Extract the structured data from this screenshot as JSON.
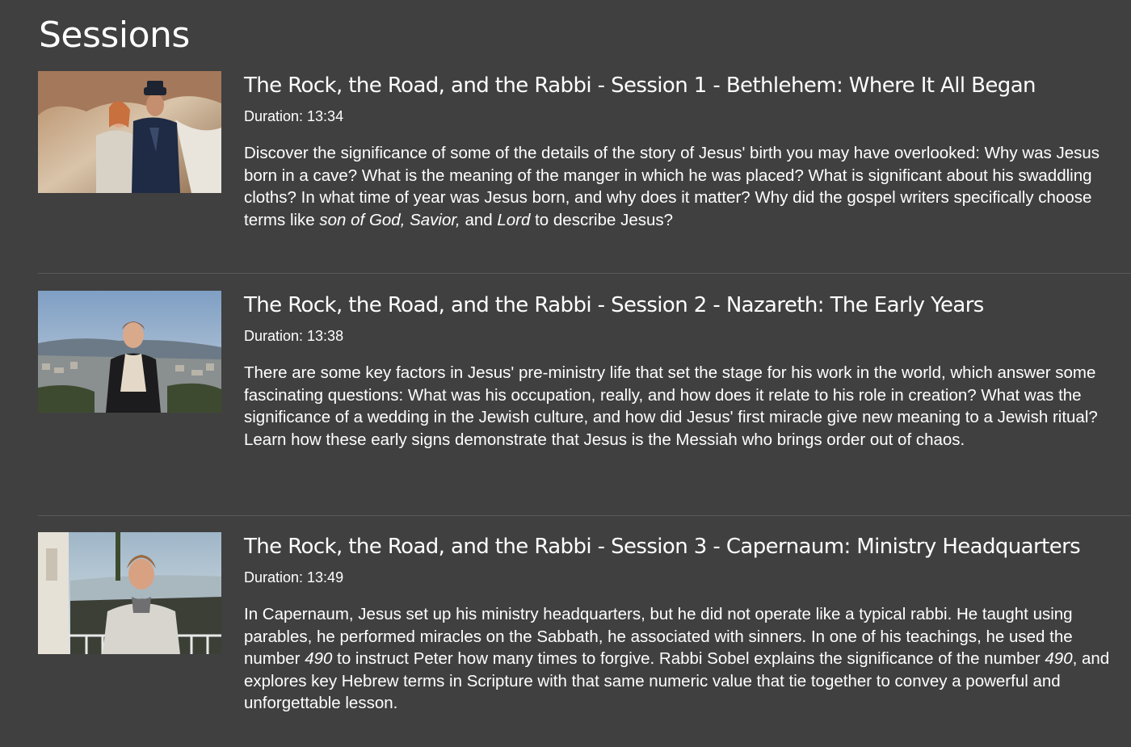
{
  "heading": "Sessions",
  "sessions": [
    {
      "title": "The Rock, the Road, and the Rabbi - Session 1 - Bethlehem: Where It All Began",
      "duration": "Duration: 13:34",
      "thumbnail": "two presenters talking in a cave",
      "description": [
        {
          "t": "Discover the significance of some of the details of the story of Jesus' birth you may have overlooked: Why was Jesus born in a cave? What is the meaning of the manger in which he was placed? What is significant about his swaddling cloths? In what time of year was Jesus born, and why does it matter? Why did the gospel writers specifically choose terms like "
        },
        {
          "t": "son of God, Savior,",
          "i": true
        },
        {
          "t": " and "
        },
        {
          "t": "Lord",
          "i": true
        },
        {
          "t": " to describe Jesus?"
        }
      ]
    },
    {
      "title": "The Rock, the Road, and the Rabbi - Session 2 - Nazareth: The Early Years",
      "duration": "Duration: 13:38",
      "thumbnail": "presenter on hillside overlooking Nazareth",
      "description": [
        {
          "t": "There are some key factors in Jesus' pre-ministry life that set the stage for his work in the world, which answer some fascinating questions: What was his occupation, really, and how does it relate to his role in creation? What was the significance of a wedding in the Jewish culture, and how did Jesus' first miracle give new meaning to a Jewish ritual? Learn how these early signs demonstrate that Jesus is the Messiah who brings order out of chaos."
        }
      ]
    },
    {
      "title": "The Rock, the Road, and the Rabbi - Session 3 - Capernaum: Ministry Headquarters",
      "duration": "Duration: 13:49",
      "thumbnail": "presenter smiling outdoors by the sea",
      "description": [
        {
          "t": "In Capernaum, Jesus set up his ministry headquarters, but he did not operate like a typical rabbi. He taught using parables, he performed miracles on the Sabbath, he associated with sinners. In one of his teachings, he used the number "
        },
        {
          "t": "490",
          "i": true
        },
        {
          "t": " to instruct Peter how many times to forgive. Rabbi Sobel explains the significance of the number "
        },
        {
          "t": "490",
          "i": true
        },
        {
          "t": ", and explores key Hebrew terms in Scripture with that same numeric value that tie together to convey a powerful and unforgettable lesson."
        }
      ]
    }
  ],
  "colors": {
    "background": "#404040",
    "text": "#ffffff",
    "divider": "#5a5a5a"
  }
}
